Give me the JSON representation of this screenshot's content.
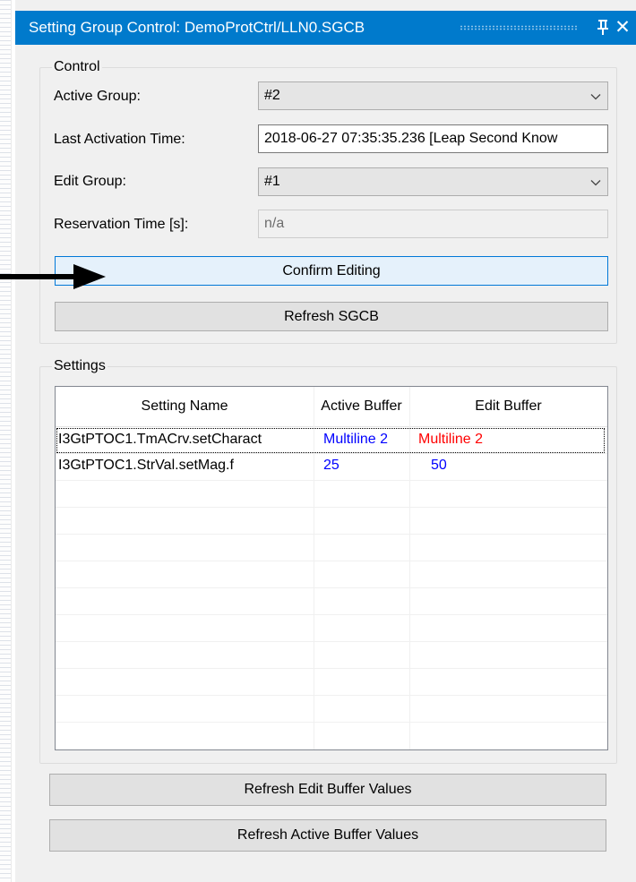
{
  "window": {
    "title": "Setting Group Control: DemoProtCtrl/LLN0.SGCB",
    "pin_icon": "pin-icon",
    "close_icon": "close-icon",
    "close_glyph": "✕"
  },
  "control": {
    "group_label": "Control",
    "active_group": {
      "label": "Active Group:",
      "value": "#2"
    },
    "last_activation": {
      "label": "Last Activation Time:",
      "value": "2018-06-27 07:35:35.236 [Leap Second Know"
    },
    "edit_group": {
      "label": "Edit Group:",
      "value": "#1"
    },
    "reservation_time": {
      "label": "Reservation Time [s]:",
      "value": "n/a"
    },
    "confirm_button": "Confirm Editing",
    "refresh_sgcb_button": "Refresh SGCB"
  },
  "settings": {
    "group_label": "Settings",
    "columns": [
      "Setting Name",
      "Active Buffer",
      "Edit Buffer"
    ],
    "rows": [
      {
        "name": "I3GtPTOC1.TmACrv.setCharact",
        "active": "Multiline 2",
        "edit": "Multiline 2"
      },
      {
        "name": "I3GtPTOC1.StrVal.setMag.f",
        "active": "25",
        "edit": "50"
      }
    ],
    "refresh_edit_button": "Refresh Edit Buffer Values",
    "refresh_active_button": "Refresh Active Buffer Values"
  },
  "colors": {
    "title_bar": "#007acc",
    "active_value": "#0000ff",
    "edit_changed_value": "#ff0000",
    "edit_value": "#0000ff"
  },
  "annotation": {
    "arrow_icon": "arrow-right-icon"
  }
}
